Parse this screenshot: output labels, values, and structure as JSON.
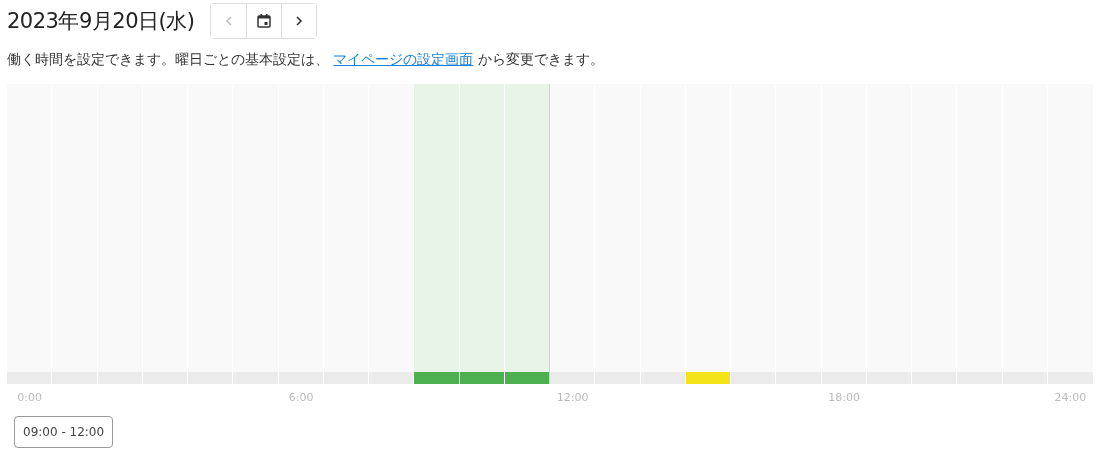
{
  "header": {
    "date": "2023年9月20日(水)",
    "nav": [
      {
        "kind": "prev",
        "disabled": true
      },
      {
        "kind": "calendar",
        "disabled": false
      },
      {
        "kind": "next",
        "disabled": false
      }
    ]
  },
  "description": {
    "before": "働く時間を設定できます。曜日ごとの基本設定は、",
    "link": "マイページの設定画面",
    "after": "から変更できます。"
  },
  "timeline": {
    "slots": [
      {
        "kind": "none",
        "selected": false,
        "label": "0:00"
      },
      {
        "kind": "none",
        "selected": false
      },
      {
        "kind": "none",
        "selected": false
      },
      {
        "kind": "none",
        "selected": false
      },
      {
        "kind": "none",
        "selected": false
      },
      {
        "kind": "none",
        "selected": false
      },
      {
        "kind": "none",
        "selected": false,
        "label": "6:00"
      },
      {
        "kind": "none",
        "selected": false
      },
      {
        "kind": "none",
        "selected": false
      },
      {
        "kind": "work",
        "selected": true
      },
      {
        "kind": "work",
        "selected": true
      },
      {
        "kind": "work",
        "selected": true,
        "marker_after": true
      },
      {
        "kind": "none",
        "selected": false,
        "label": "12:00"
      },
      {
        "kind": "none",
        "selected": false
      },
      {
        "kind": "none",
        "selected": false
      },
      {
        "kind": "event",
        "selected": false
      },
      {
        "kind": "none",
        "selected": false
      },
      {
        "kind": "none",
        "selected": false
      },
      {
        "kind": "none",
        "selected": false,
        "label": "18:00"
      },
      {
        "kind": "none",
        "selected": false
      },
      {
        "kind": "none",
        "selected": false
      },
      {
        "kind": "none",
        "selected": false
      },
      {
        "kind": "none",
        "selected": false
      },
      {
        "kind": "none",
        "selected": false,
        "label": "24:00"
      }
    ]
  },
  "ranges": [
    {
      "label": "09:00 - 12:00"
    }
  ]
}
